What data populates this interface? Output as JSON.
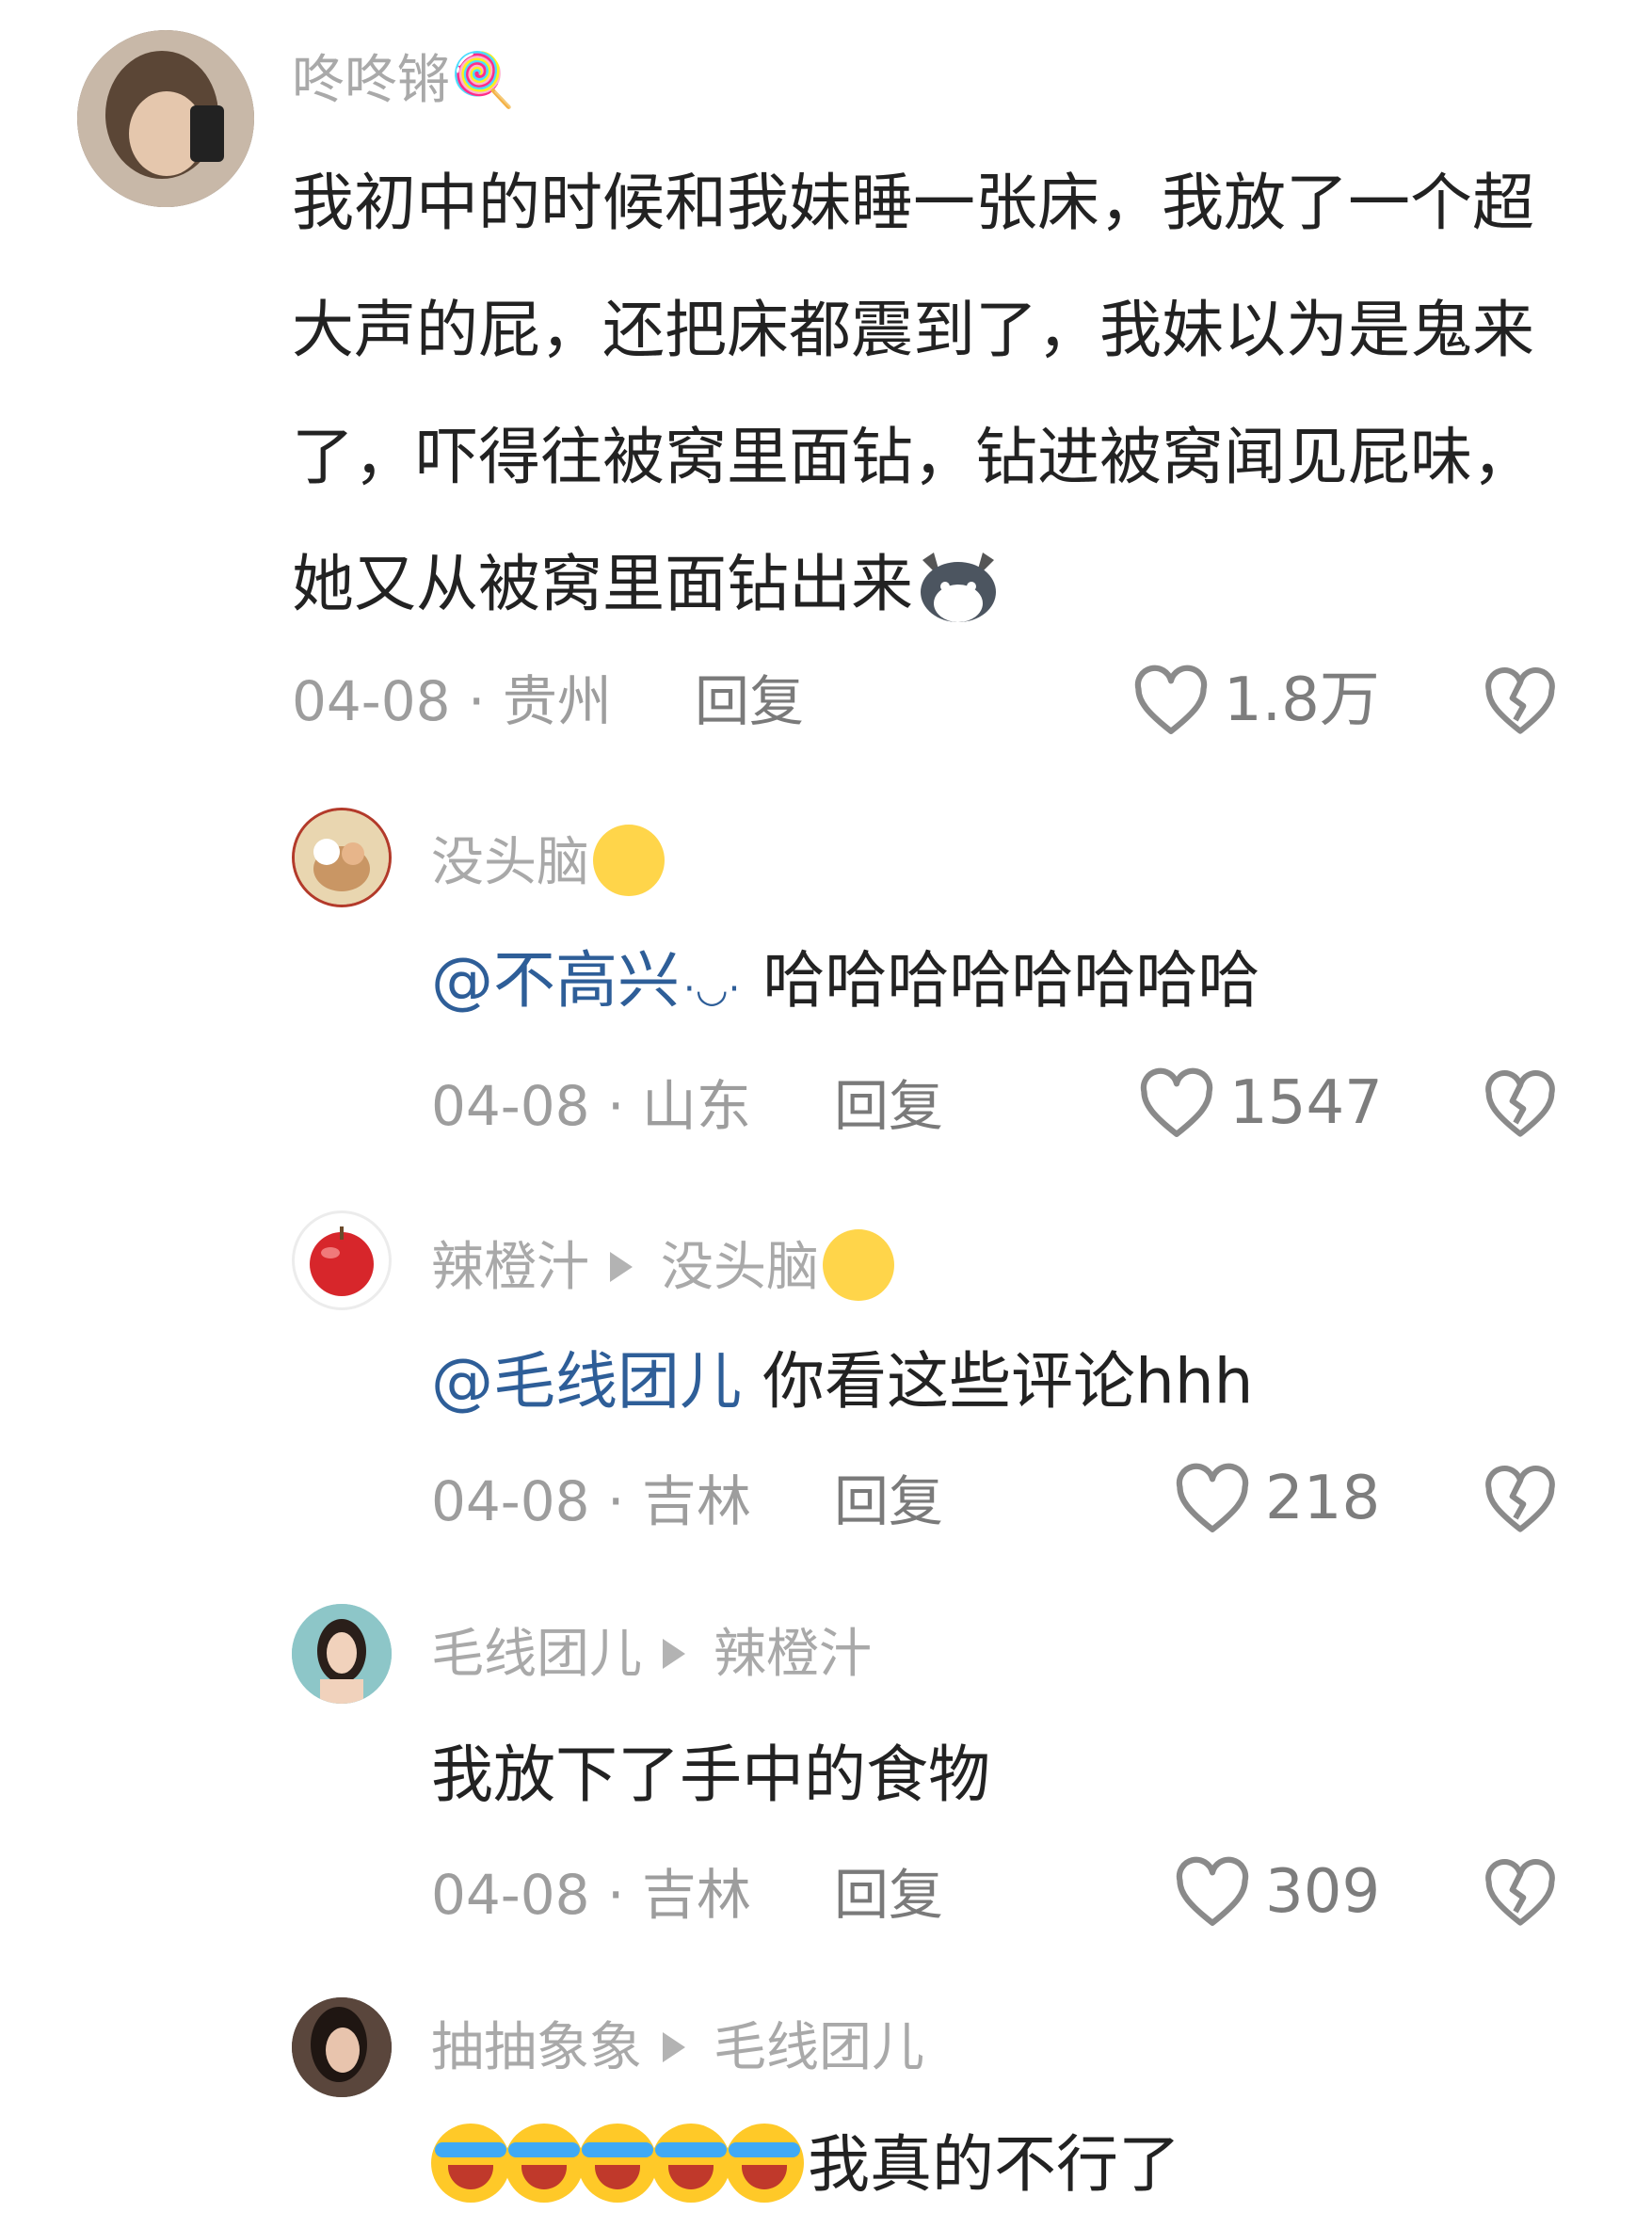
{
  "comments": [
    {
      "username": "咚咚锵🍭",
      "text": "我初中的时候和我妹睡一张床，我放了一个超大声的屁，还把床都震到了，我妹以为是鬼来了，吓得往被窝里面钻，钻进被窝闻见屁味，她又从被窝里面钻出来",
      "date_loc": "04-08 · 贵州",
      "reply": "回复",
      "likes": "1.8万"
    },
    {
      "username": "没头脑",
      "mention": "@不高兴",
      "text": "哈哈哈哈哈哈哈哈",
      "date_loc": "04-08 · 山东",
      "reply": "回复",
      "likes": "1547"
    },
    {
      "username": "辣橙汁",
      "reply_to": "没头脑",
      "mention": "@毛线团儿",
      "text": "你看这些评论hhh",
      "date_loc": "04-08 · 吉林",
      "reply": "回复",
      "likes": "218"
    },
    {
      "username": "毛线团儿",
      "reply_to": "辣橙汁",
      "text": "我放下了手中的食物",
      "date_loc": "04-08 · 吉林",
      "reply": "回复",
      "likes": "309"
    },
    {
      "username": "抽抽象象",
      "reply_to": "毛线团儿",
      "text": "我真的不行了"
    }
  ]
}
